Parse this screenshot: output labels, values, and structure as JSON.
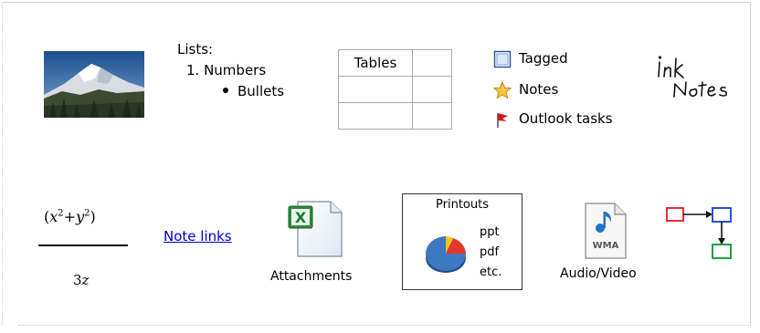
{
  "lists": {
    "title": "Lists:",
    "numbered": "1.  Numbers",
    "bulleted": "Bullets"
  },
  "table": {
    "header": "Tables"
  },
  "tags": {
    "items": [
      {
        "label": "Tagged",
        "icon": "checkbox-icon"
      },
      {
        "label": "Notes",
        "icon": "star-icon"
      },
      {
        "label": "Outlook tasks",
        "icon": "flag-icon"
      }
    ]
  },
  "ink": {
    "line1": "Ink",
    "line2": "Notes"
  },
  "equation": {
    "numerator": "(x²+y²)",
    "denominator": "3z"
  },
  "note_links": {
    "label": "Note links"
  },
  "attachments": {
    "label": "Attachments",
    "icon": "excel-file-icon",
    "glyph": "X"
  },
  "printouts": {
    "title": "Printouts",
    "formats": [
      "ppt",
      "pdf",
      "etc."
    ]
  },
  "audio_video": {
    "label": "Audio/Video",
    "file_type": "WMA"
  },
  "colors": {
    "link": "#0000cc",
    "diagram_red": "#e03030",
    "diagram_blue": "#2a4fd6",
    "diagram_green": "#22a040"
  }
}
